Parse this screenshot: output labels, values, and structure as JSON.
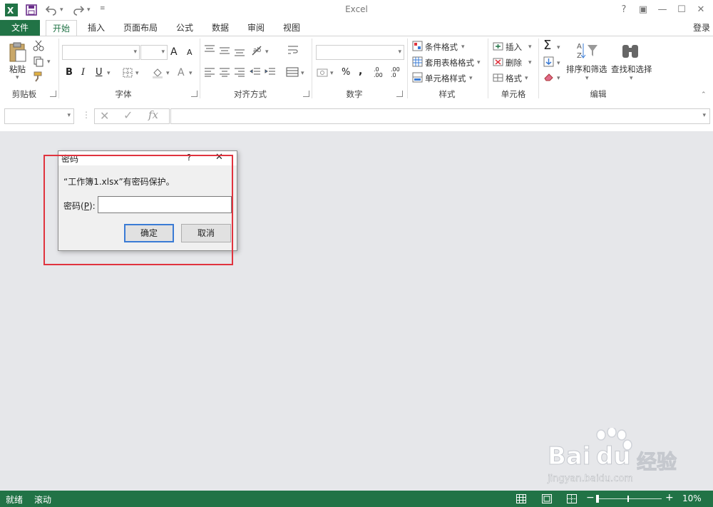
{
  "app": {
    "title": "Excel"
  },
  "titlebar": {
    "help": "?",
    "ribbon_display": "▣",
    "minimize": "—",
    "maximize": "☐",
    "close": "✕"
  },
  "tabs": {
    "file": "文件",
    "home": "开始",
    "insert": "插入",
    "page_layout": "页面布局",
    "formulas": "公式",
    "data": "数据",
    "review": "审阅",
    "view": "视图",
    "login": "登录"
  },
  "ribbon": {
    "clipboard": {
      "paste": "粘贴",
      "group": "剪贴板"
    },
    "font": {
      "group": "字体",
      "bold": "B",
      "italic": "I",
      "underline": "U",
      "grow": "A",
      "shrink": "A",
      "color": "A"
    },
    "alignment": {
      "group": "对齐方式"
    },
    "number": {
      "group": "数字",
      "percent": "%",
      "comma": ",",
      "inc": ".00",
      "dec": ".0"
    },
    "styles": {
      "group": "样式",
      "conditional": "条件格式",
      "table": "套用表格格式",
      "cell": "单元格样式"
    },
    "cells": {
      "group": "单元格",
      "insert": "插入",
      "delete": "删除",
      "format": "格式"
    },
    "editing": {
      "group": "编辑",
      "sort": "排序和筛选",
      "find": "查找和选择"
    }
  },
  "formula_bar": {
    "fx": "fx"
  },
  "dialog": {
    "title": "密码",
    "help": "?",
    "close": "✕",
    "message": "“工作簿1.xlsx”有密码保护。",
    "password_label": "密码(",
    "password_key": "P",
    "password_label_end": "):",
    "password_value": "",
    "ok": "确定",
    "cancel": "取消"
  },
  "statusbar": {
    "ready": "就绪",
    "scroll": "滚动",
    "zoom": "10%",
    "zoom_minus": "−",
    "zoom_plus": "+"
  },
  "watermark": {
    "brand": "Bai",
    "brand2": "du",
    "product": "经验",
    "url": "jingyan.baidu.com"
  },
  "colors": {
    "accent": "#217346",
    "highlight": "#e0333e",
    "workspace": "#e6e7ea",
    "dialog_primary": "#3a7bd5"
  }
}
